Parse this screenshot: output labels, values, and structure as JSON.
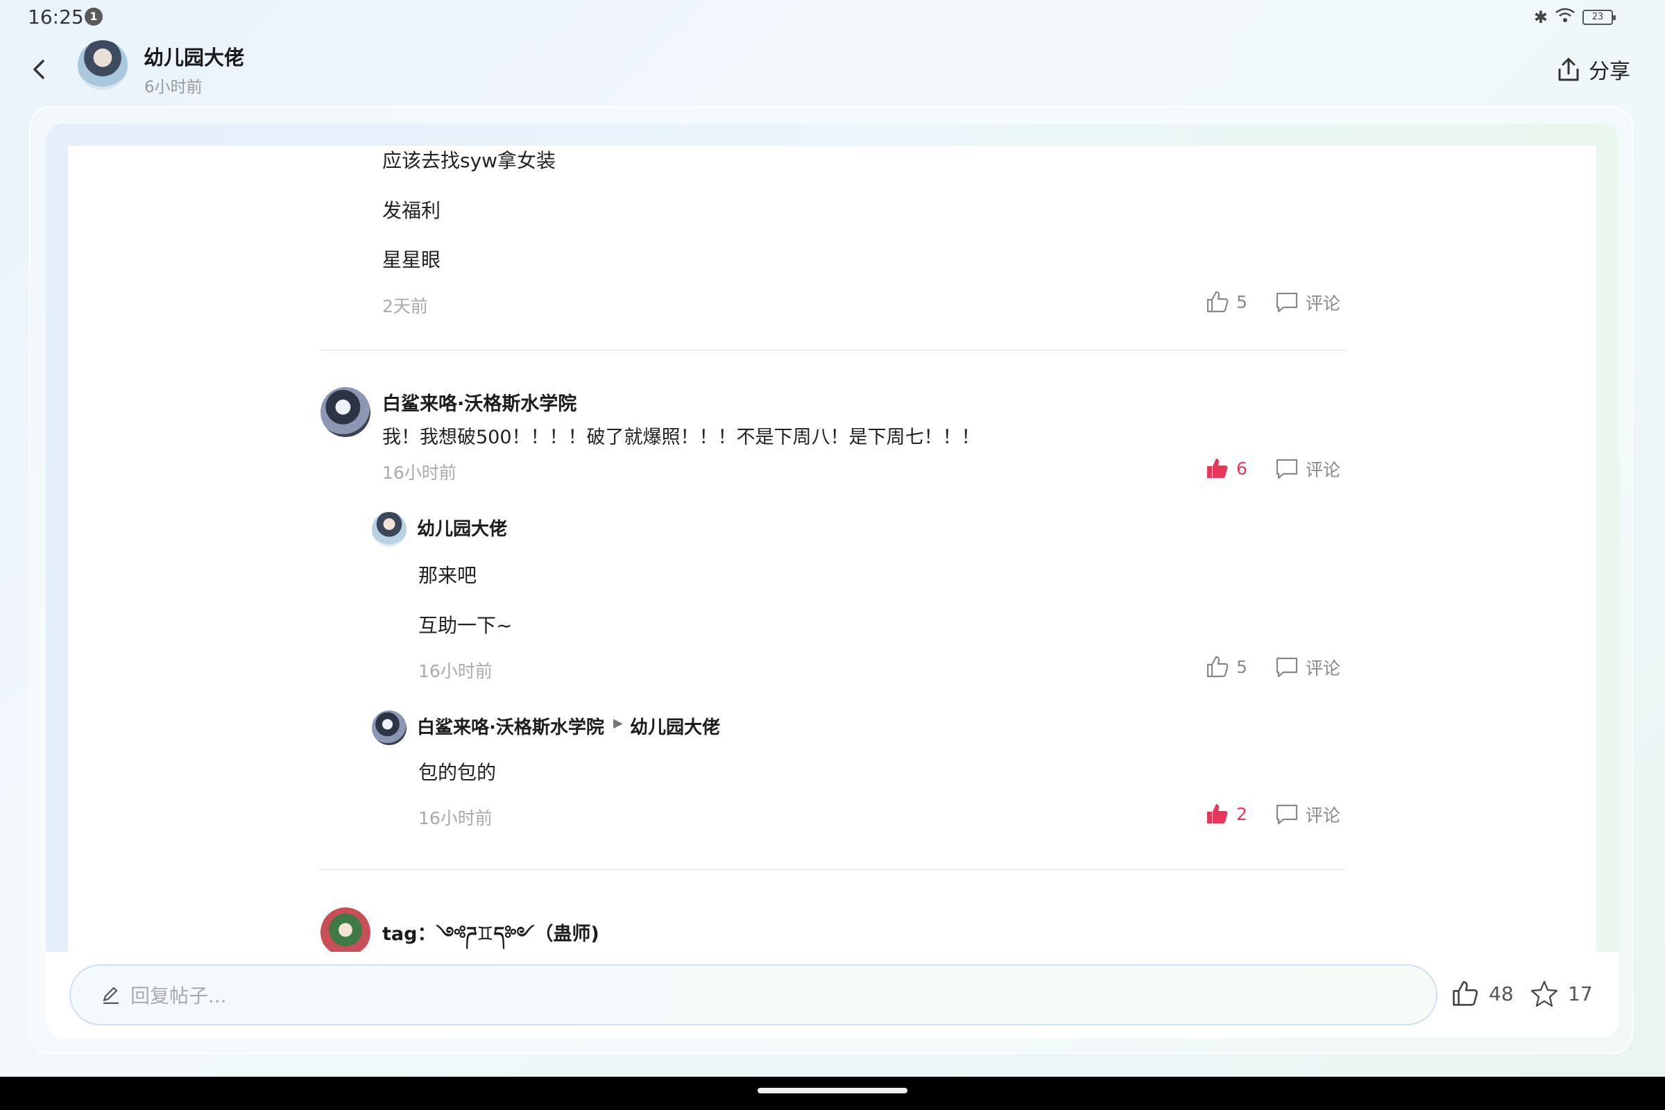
{
  "status_bar": {
    "time": "16:25",
    "notification_count": "1",
    "battery_level": "23",
    "icons": [
      "bluetooth-icon",
      "wifi-icon",
      "battery-icon"
    ]
  },
  "header": {
    "author_name": "幼儿园大佬",
    "post_time": "6小时前",
    "share_label": "分享"
  },
  "comments": [
    {
      "lines": [
        "应该去找syw拿女装",
        "发福利",
        "星星眼"
      ],
      "time": "2天前",
      "likes": "5",
      "liked": false,
      "comment_label": "评论"
    },
    {
      "username": "白鲨来咯·沃格斯水学院",
      "text": "我！我想破500！！！！破了就爆照！！！不是下周八！是下周七！！！",
      "time": "16小时前",
      "likes": "6",
      "liked": true,
      "comment_label": "评论",
      "replies": [
        {
          "username": "幼儿园大佬",
          "lines": [
            "那来吧",
            "互助一下~"
          ],
          "time": "16小时前",
          "likes": "5",
          "liked": false,
          "comment_label": "评论"
        },
        {
          "username": "白鲨来咯·沃格斯水学院",
          "reply_to": "幼儿园大佬",
          "lines": [
            "包的包的"
          ],
          "time": "16小时前",
          "likes": "2",
          "liked": true,
          "comment_label": "评论"
        }
      ]
    },
    {
      "username": "tag：༺ཌ♊ད༻（蛊师)"
    }
  ],
  "bottom_bar": {
    "reply_placeholder": "回复帖子...",
    "likes": "48",
    "favorites": "17"
  },
  "colors": {
    "liked": "#e6375b",
    "muted": "#aaaaaa"
  }
}
